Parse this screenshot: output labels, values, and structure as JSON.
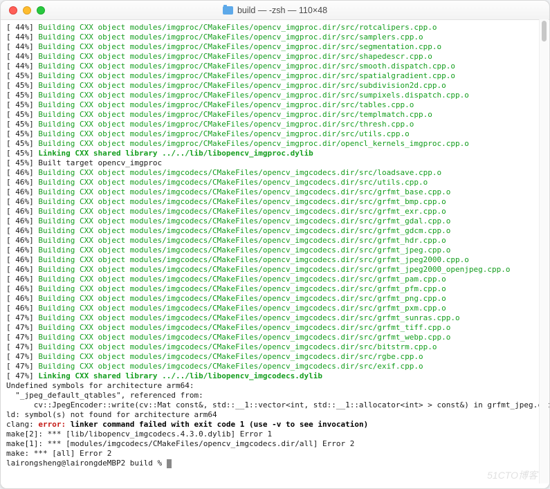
{
  "window": {
    "title": "build — -zsh — 110×48"
  },
  "lines": [
    {
      "pct": "44",
      "cls": "g",
      "txt": "Building CXX object modules/imgproc/CMakeFiles/opencv_imgproc.dir/src/rotcalipers.cpp.o"
    },
    {
      "pct": "44",
      "cls": "g",
      "txt": "Building CXX object modules/imgproc/CMakeFiles/opencv_imgproc.dir/src/samplers.cpp.o"
    },
    {
      "pct": "44",
      "cls": "g",
      "txt": "Building CXX object modules/imgproc/CMakeFiles/opencv_imgproc.dir/src/segmentation.cpp.o"
    },
    {
      "pct": "44",
      "cls": "g",
      "txt": "Building CXX object modules/imgproc/CMakeFiles/opencv_imgproc.dir/src/shapedescr.cpp.o"
    },
    {
      "pct": "44",
      "cls": "g",
      "txt": "Building CXX object modules/imgproc/CMakeFiles/opencv_imgproc.dir/src/smooth.dispatch.cpp.o"
    },
    {
      "pct": "45",
      "cls": "g",
      "txt": "Building CXX object modules/imgproc/CMakeFiles/opencv_imgproc.dir/src/spatialgradient.cpp.o"
    },
    {
      "pct": "45",
      "cls": "g",
      "txt": "Building CXX object modules/imgproc/CMakeFiles/opencv_imgproc.dir/src/subdivision2d.cpp.o"
    },
    {
      "pct": "45",
      "cls": "g",
      "txt": "Building CXX object modules/imgproc/CMakeFiles/opencv_imgproc.dir/src/sumpixels.dispatch.cpp.o"
    },
    {
      "pct": "45",
      "cls": "g",
      "txt": "Building CXX object modules/imgproc/CMakeFiles/opencv_imgproc.dir/src/tables.cpp.o"
    },
    {
      "pct": "45",
      "cls": "g",
      "txt": "Building CXX object modules/imgproc/CMakeFiles/opencv_imgproc.dir/src/templmatch.cpp.o"
    },
    {
      "pct": "45",
      "cls": "g",
      "txt": "Building CXX object modules/imgproc/CMakeFiles/opencv_imgproc.dir/src/thresh.cpp.o"
    },
    {
      "pct": "45",
      "cls": "g",
      "txt": "Building CXX object modules/imgproc/CMakeFiles/opencv_imgproc.dir/src/utils.cpp.o"
    },
    {
      "pct": "45",
      "cls": "g",
      "txt": "Building CXX object modules/imgproc/CMakeFiles/opencv_imgproc.dir/opencl_kernels_imgproc.cpp.o"
    },
    {
      "pct": "45",
      "cls": "b",
      "txt": "Linking CXX shared library ../../lib/libopencv_imgproc.dylib"
    },
    {
      "pct": "45",
      "cls": "",
      "txt": "Built target opencv_imgproc"
    },
    {
      "pct": "46",
      "cls": "g",
      "txt": "Building CXX object modules/imgcodecs/CMakeFiles/opencv_imgcodecs.dir/src/loadsave.cpp.o"
    },
    {
      "pct": "46",
      "cls": "g",
      "txt": "Building CXX object modules/imgcodecs/CMakeFiles/opencv_imgcodecs.dir/src/utils.cpp.o"
    },
    {
      "pct": "46",
      "cls": "g",
      "txt": "Building CXX object modules/imgcodecs/CMakeFiles/opencv_imgcodecs.dir/src/grfmt_base.cpp.o"
    },
    {
      "pct": "46",
      "cls": "g",
      "txt": "Building CXX object modules/imgcodecs/CMakeFiles/opencv_imgcodecs.dir/src/grfmt_bmp.cpp.o"
    },
    {
      "pct": "46",
      "cls": "g",
      "txt": "Building CXX object modules/imgcodecs/CMakeFiles/opencv_imgcodecs.dir/src/grfmt_exr.cpp.o"
    },
    {
      "pct": "46",
      "cls": "g",
      "txt": "Building CXX object modules/imgcodecs/CMakeFiles/opencv_imgcodecs.dir/src/grfmt_gdal.cpp.o"
    },
    {
      "pct": "46",
      "cls": "g",
      "txt": "Building CXX object modules/imgcodecs/CMakeFiles/opencv_imgcodecs.dir/src/grfmt_gdcm.cpp.o"
    },
    {
      "pct": "46",
      "cls": "g",
      "txt": "Building CXX object modules/imgcodecs/CMakeFiles/opencv_imgcodecs.dir/src/grfmt_hdr.cpp.o"
    },
    {
      "pct": "46",
      "cls": "g",
      "txt": "Building CXX object modules/imgcodecs/CMakeFiles/opencv_imgcodecs.dir/src/grfmt_jpeg.cpp.o"
    },
    {
      "pct": "46",
      "cls": "g",
      "txt": "Building CXX object modules/imgcodecs/CMakeFiles/opencv_imgcodecs.dir/src/grfmt_jpeg2000.cpp.o"
    },
    {
      "pct": "46",
      "cls": "g",
      "txt": "Building CXX object modules/imgcodecs/CMakeFiles/opencv_imgcodecs.dir/src/grfmt_jpeg2000_openjpeg.cpp.o"
    },
    {
      "pct": "46",
      "cls": "g",
      "txt": "Building CXX object modules/imgcodecs/CMakeFiles/opencv_imgcodecs.dir/src/grfmt_pam.cpp.o"
    },
    {
      "pct": "46",
      "cls": "g",
      "txt": "Building CXX object modules/imgcodecs/CMakeFiles/opencv_imgcodecs.dir/src/grfmt_pfm.cpp.o"
    },
    {
      "pct": "46",
      "cls": "g",
      "txt": "Building CXX object modules/imgcodecs/CMakeFiles/opencv_imgcodecs.dir/src/grfmt_png.cpp.o"
    },
    {
      "pct": "46",
      "cls": "g",
      "txt": "Building CXX object modules/imgcodecs/CMakeFiles/opencv_imgcodecs.dir/src/grfmt_pxm.cpp.o"
    },
    {
      "pct": "47",
      "cls": "g",
      "txt": "Building CXX object modules/imgcodecs/CMakeFiles/opencv_imgcodecs.dir/src/grfmt_sunras.cpp.o"
    },
    {
      "pct": "47",
      "cls": "g",
      "txt": "Building CXX object modules/imgcodecs/CMakeFiles/opencv_imgcodecs.dir/src/grfmt_tiff.cpp.o"
    },
    {
      "pct": "47",
      "cls": "g",
      "txt": "Building CXX object modules/imgcodecs/CMakeFiles/opencv_imgcodecs.dir/src/grfmt_webp.cpp.o"
    },
    {
      "pct": "47",
      "cls": "g",
      "txt": "Building CXX object modules/imgcodecs/CMakeFiles/opencv_imgcodecs.dir/src/bitstrm.cpp.o"
    },
    {
      "pct": "47",
      "cls": "g",
      "txt": "Building CXX object modules/imgcodecs/CMakeFiles/opencv_imgcodecs.dir/src/rgbe.cpp.o"
    },
    {
      "pct": "47",
      "cls": "g",
      "txt": "Building CXX object modules/imgcodecs/CMakeFiles/opencv_imgcodecs.dir/src/exif.cpp.o"
    },
    {
      "pct": "47",
      "cls": "b",
      "txt": "Linking CXX shared library ../../lib/libopencv_imgcodecs.dylib"
    }
  ],
  "errors": [
    "Undefined symbols for architecture arm64:",
    "  \"_jpeg_default_qtables\", referenced from:",
    "      cv::JpegEncoder::write(cv::Mat const&, std::__1::vector<int, std::__1::allocator<int> > const&) in grfmt_jpeg.cpp.o",
    "ld: symbol(s) not found for architecture arm64"
  ],
  "clang_prefix": "clang: ",
  "clang_error": "error: ",
  "clang_msg": "linker command failed with exit code 1 (use -v to see invocation)",
  "make_lines": [
    "make[2]: *** [lib/libopencv_imgcodecs.4.3.0.dylib] Error 1",
    "make[1]: *** [modules/imgcodecs/CMakeFiles/opencv_imgcodecs.dir/all] Error 2",
    "make: *** [all] Error 2"
  ],
  "prompt": "lairongsheng@lairongdeMBP2 build % ",
  "watermark": "51CTO博客"
}
